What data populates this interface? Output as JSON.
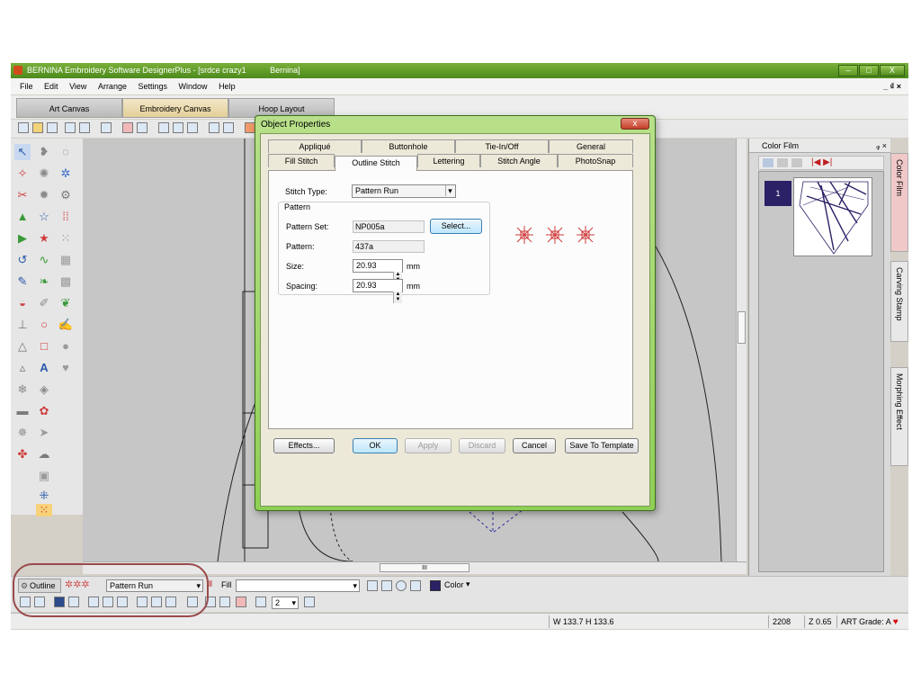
{
  "window": {
    "title": "BERNINA Embroidery Software DesignerPlus - [srdce crazy1",
    "title_machine": "Bernina]",
    "minimize": "–",
    "maximize": "□",
    "close": "X",
    "child_controls": "_ ₫ ×"
  },
  "menu": [
    "File",
    "Edit",
    "View",
    "Arrange",
    "Settings",
    "Window",
    "Help"
  ],
  "mode_tabs": [
    "Art Canvas",
    "Embroidery Canvas",
    "Hoop Layout"
  ],
  "active_mode": "Embroidery Canvas",
  "color_film": {
    "title": "Color Film",
    "pin": "ᵩ ×",
    "swatch_number": "1",
    "swatch_color": "#2a2166"
  },
  "side_tabs": [
    "Color Film",
    "Carving Stamp",
    "Morphing Effect"
  ],
  "dialog": {
    "title": "Object Properties",
    "close": "x",
    "tabs_row1": [
      "Appliqué",
      "Buttonhole",
      "Tie-In/Off",
      "General"
    ],
    "tabs_row2": [
      "Fill Stitch",
      "Outline Stitch",
      "Lettering",
      "Stitch Angle",
      "PhotoSnap"
    ],
    "active_tab": "Outline Stitch",
    "stitch_type_label": "Stitch Type:",
    "stitch_type_value": "Pattern Run",
    "pattern_group": "Pattern",
    "pattern_set_label": "Pattern Set:",
    "pattern_set_value": "NP005a",
    "select_button": "Select...",
    "pattern_label": "Pattern:",
    "pattern_value": "437a",
    "size_label": "Size:",
    "size_value": "20.93",
    "size_unit": "mm",
    "spacing_label": "Spacing:",
    "spacing_value": "20.93",
    "spacing_unit": "mm",
    "buttons": {
      "effects": "Effects...",
      "ok": "OK",
      "apply": "Apply",
      "discard": "Discard",
      "cancel": "Cancel",
      "save_template": "Save To Template"
    }
  },
  "property_bar": {
    "outline_label": "Outline",
    "outline_type": "Pattern Run",
    "fill_label": "Fill",
    "color_label": "Color",
    "color_swatch": "#2a2166",
    "repeat_value": "2"
  },
  "status": {
    "dimensions": "W 133.7 H 133.6",
    "stitches": "2208",
    "zoom": "Z 0.65",
    "art_grade": "ART Grade: A"
  },
  "scroll_mark": "III"
}
